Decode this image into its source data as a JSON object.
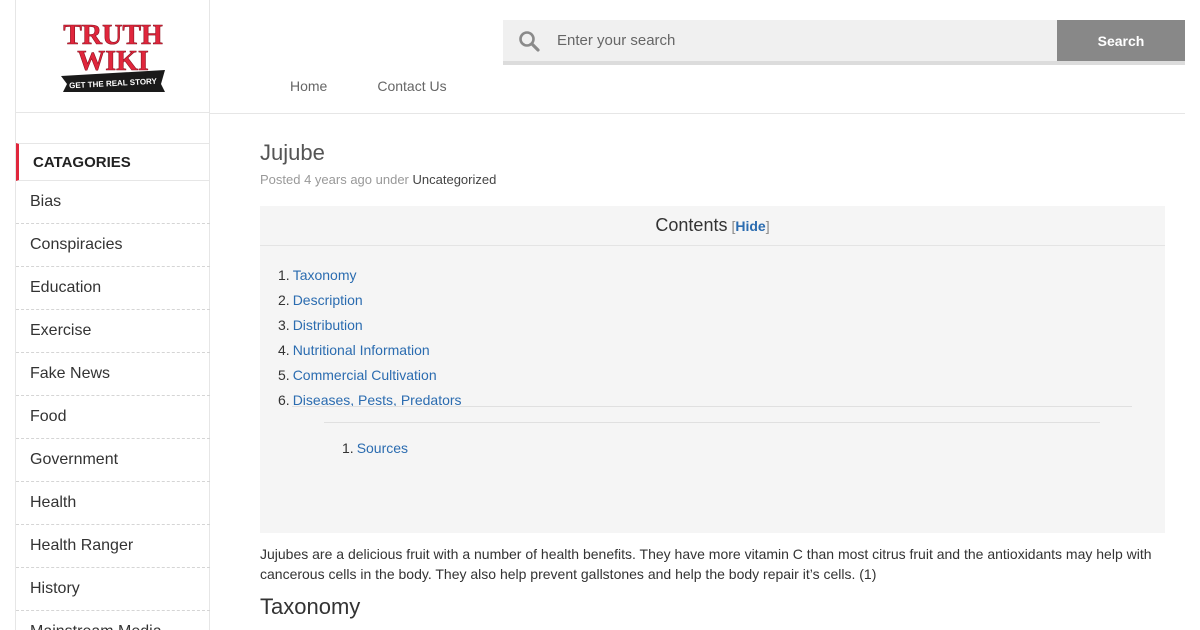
{
  "logo": {
    "line1": "TRUTH",
    "line2": "WIKI",
    "tagline": "GET THE REAL STORY"
  },
  "search": {
    "placeholder": "Enter your search",
    "button_label": "Search"
  },
  "nav": {
    "items": [
      "Home",
      "Contact Us"
    ]
  },
  "sidebar": {
    "header": "CATAGORIES",
    "items": [
      "Bias",
      "Conspiracies",
      "Education",
      "Exercise",
      "Fake News",
      "Food",
      "Government",
      "Health",
      "Health Ranger",
      "History",
      "Mainstream Media"
    ]
  },
  "post": {
    "title": "Jujube",
    "meta_prefix": "Posted 4 years ago under",
    "category": "Uncategorized"
  },
  "toc": {
    "title": "Contents",
    "hide_label": "Hide",
    "items": [
      {
        "num": "1.",
        "label": "Taxonomy"
      },
      {
        "num": "2.",
        "label": "Description"
      },
      {
        "num": "3.",
        "label": "Distribution"
      },
      {
        "num": "4.",
        "label": "Nutritional Information"
      },
      {
        "num": "5.",
        "label": "Commercial Cultivation"
      },
      {
        "num": "6.",
        "label": "Diseases, Pests, Predators"
      }
    ],
    "sub_items": [
      {
        "num": "1.",
        "label": "Sources"
      }
    ]
  },
  "body": {
    "intro": "Jujubes are a delicious fruit with a number of health benefits. They have more vitamin C than most citrus fruit and the antioxidants may help with cancerous cells in the body. They also help prevent gallstones and help the body repair it’s cells. (1)",
    "heading1": "Taxonomy"
  },
  "colors": {
    "accent": "#e0263c",
    "link": "#2b6cb0",
    "search_button": "#888888"
  }
}
